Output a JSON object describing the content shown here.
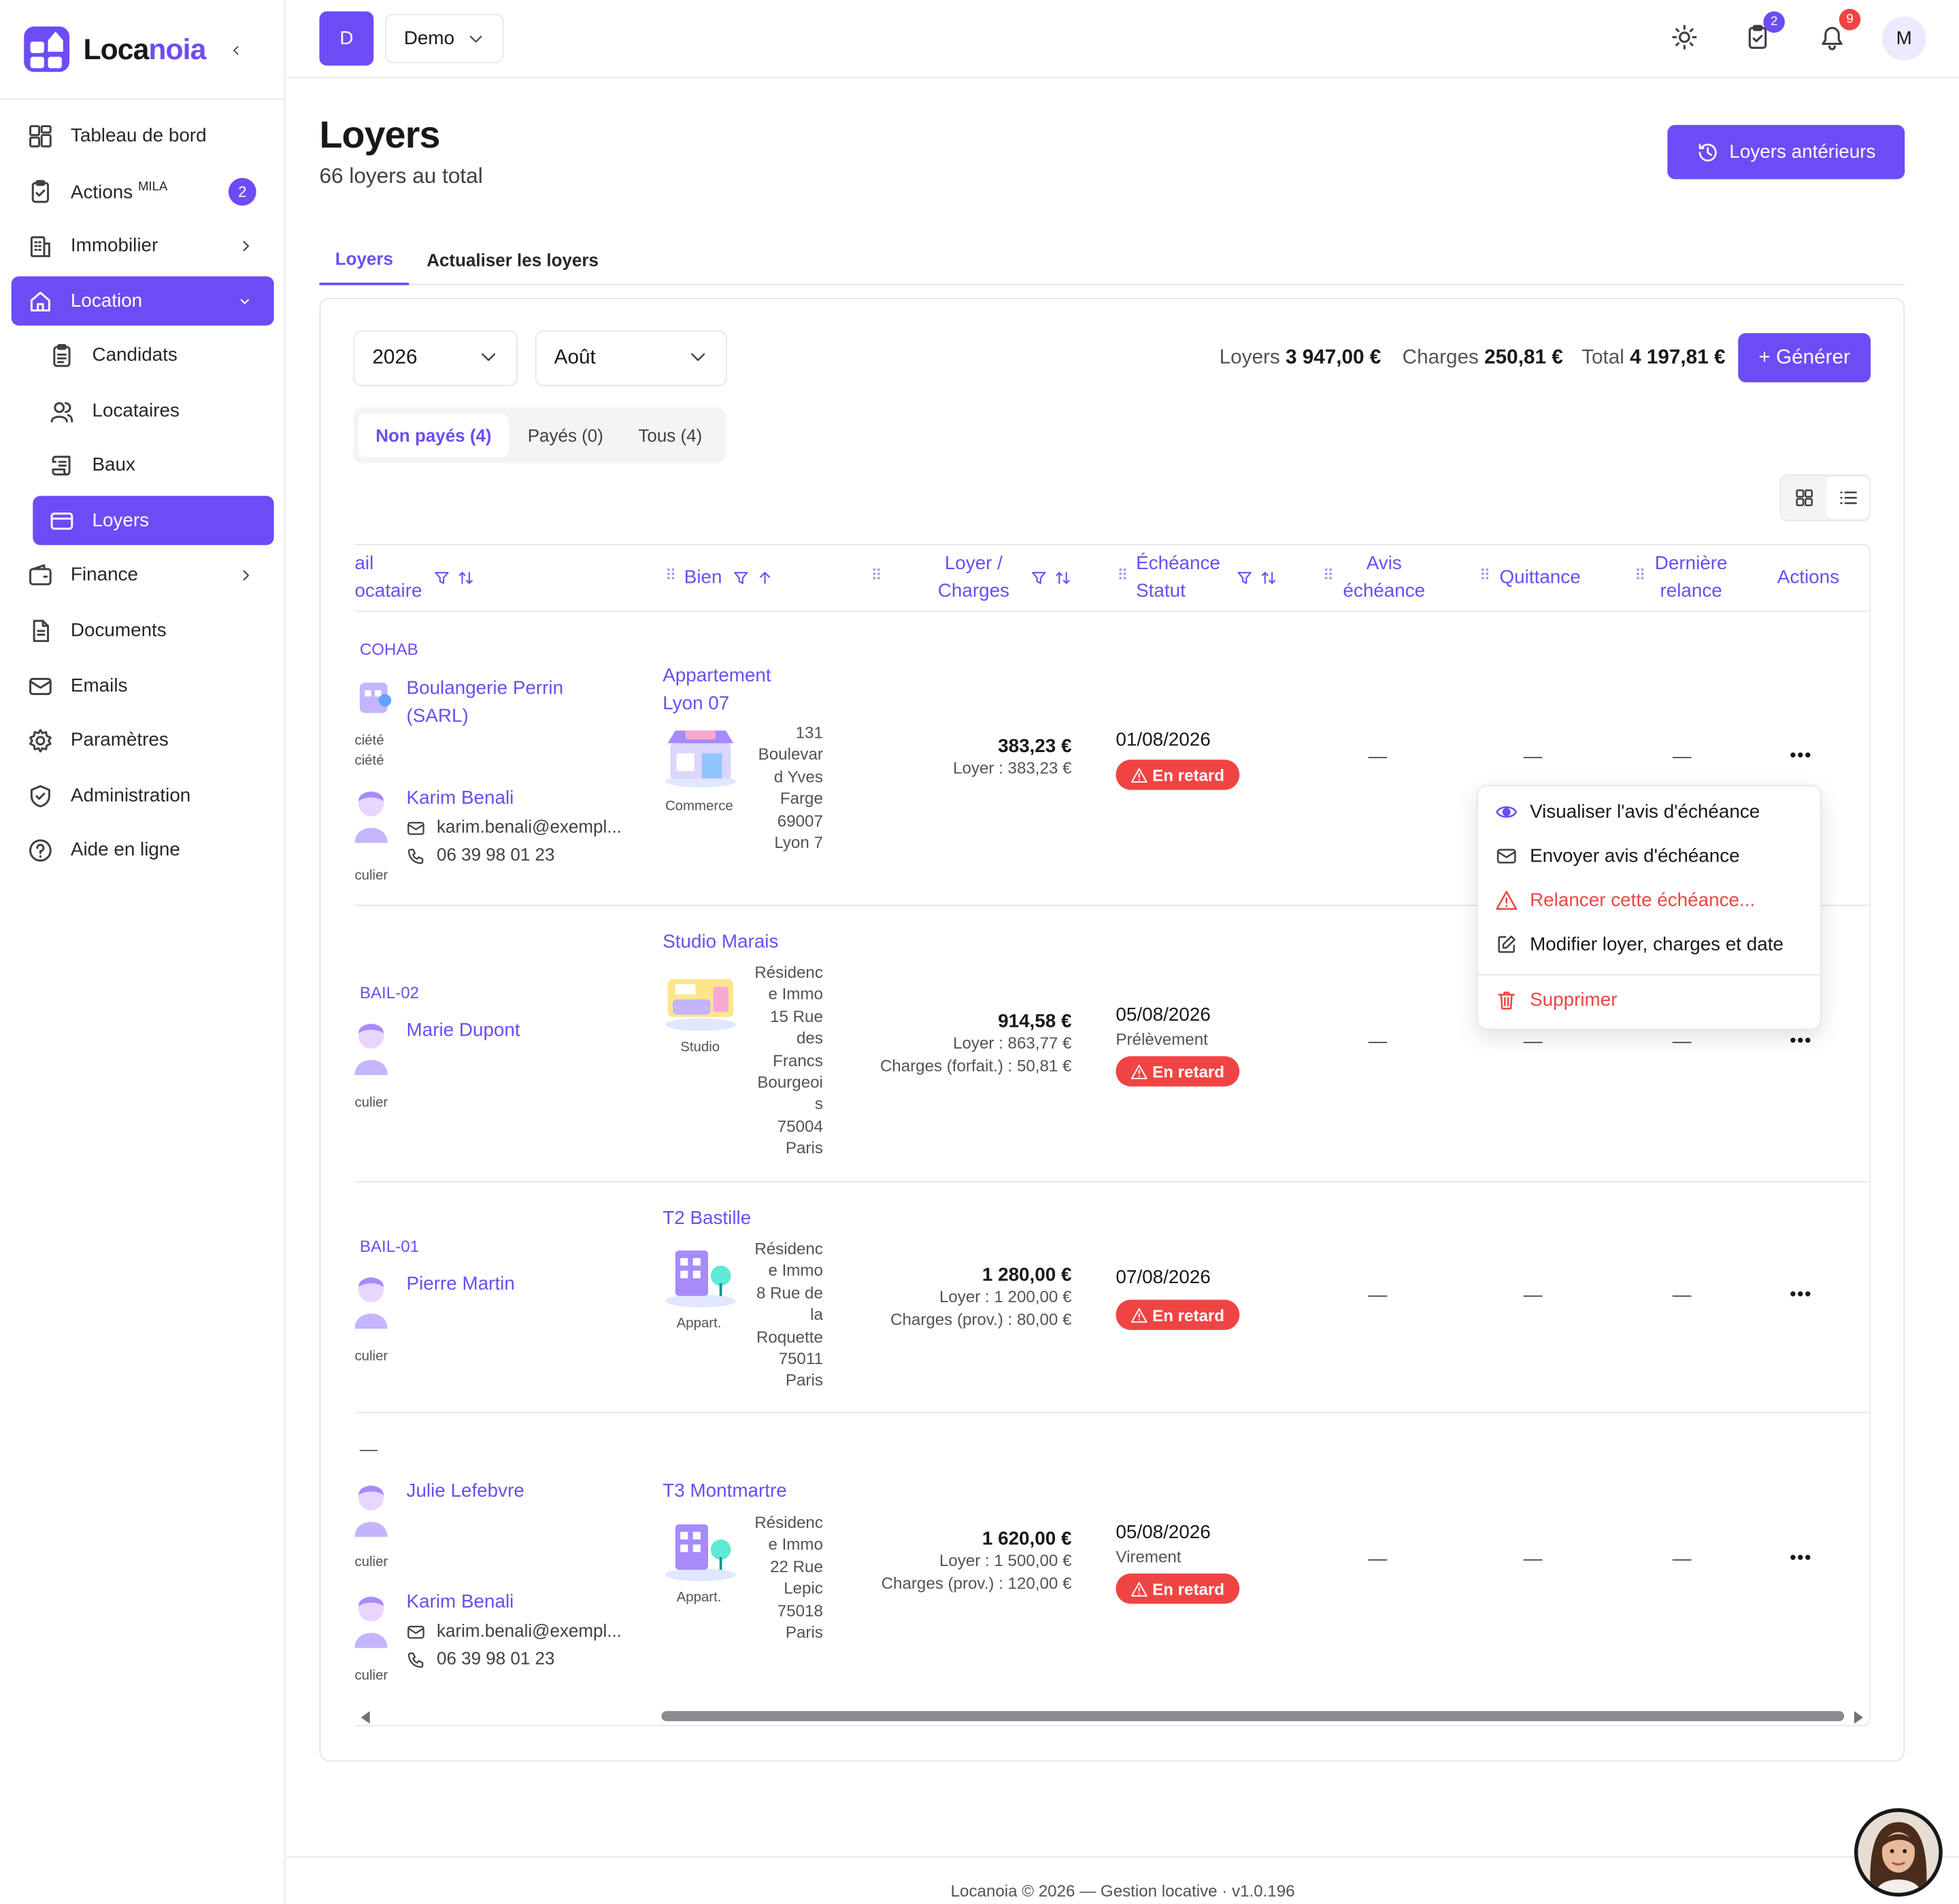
{
  "app": {
    "name_a": "Loca",
    "name_b": "noia"
  },
  "sidebar": {
    "items": [
      {
        "label": "Tableau de bord",
        "icon": "dashboard-icon"
      },
      {
        "label": "Actions",
        "sup": "MILA",
        "badge": "2",
        "icon": "clipboard-check-icon"
      },
      {
        "label": "Immobilier",
        "icon": "building-icon"
      },
      {
        "label": "Location",
        "icon": "home-icon"
      },
      {
        "label": "Candidats",
        "icon": "clipboard-list-icon"
      },
      {
        "label": "Locataires",
        "icon": "users-icon"
      },
      {
        "label": "Baux",
        "icon": "scroll-icon"
      },
      {
        "label": "Loyers",
        "icon": "credit-card-icon"
      },
      {
        "label": "Finance",
        "icon": "wallet-icon"
      },
      {
        "label": "Documents",
        "icon": "document-icon"
      },
      {
        "label": "Emails",
        "icon": "mail-icon"
      },
      {
        "label": "Paramètres",
        "icon": "gear-icon"
      },
      {
        "label": "Administration",
        "icon": "shield-icon"
      },
      {
        "label": "Aide en ligne",
        "icon": "help-circle-icon"
      }
    ]
  },
  "topbar": {
    "workspace_initial": "D",
    "workspace": "Demo",
    "tasks_badge": "2",
    "notif_badge": "9",
    "user_initial": "M"
  },
  "page": {
    "title": "Loyers",
    "subtitle": "66 loyers au total",
    "history_button": "Loyers antérieurs"
  },
  "tabs": [
    "Loyers",
    "Actualiser les loyers"
  ],
  "filters": {
    "year": "2026",
    "month": "Août"
  },
  "totals": {
    "rent_label": "Loyers",
    "rent": "3 947,00 €",
    "charges_label": "Charges",
    "charges": "250,81 €",
    "total_label": "Total",
    "total": "4 197,81 €",
    "generate": "+ Générer"
  },
  "segments": [
    "Non payés (4)",
    "Payés (0)",
    "Tous (4)"
  ],
  "columns": {
    "tenant_a": "ail",
    "tenant_b": "ocataire",
    "property": "Bien",
    "rent_a": "Loyer /",
    "rent_b": "Charges",
    "due_a": "Échéance",
    "due_b": "Statut",
    "notice_a": "Avis",
    "notice_b": "échéance",
    "receipt": "Quittance",
    "reminder_a": "Dernière",
    "reminder_b": "relance",
    "actions": "Actions"
  },
  "rows": [
    {
      "ref": "COHAB",
      "tenants": [
        {
          "name": "Boulangerie Perrin (SARL)",
          "type_a": "ciété",
          "type_b": "ciété"
        },
        {
          "name": "Karim Benali",
          "type": "culier",
          "email": "karim.benali@exempl...",
          "phone": "06 39 98 01 23"
        }
      ],
      "property": "Appartement Lyon 07",
      "kind": "Commerce",
      "address": [
        "131",
        "Boulevar",
        "d Yves",
        "Farge",
        "69007",
        "Lyon 7"
      ],
      "amount": "383,23 €",
      "detail": [
        "Loyer : 383,23 €"
      ],
      "due": "01/08/2026",
      "pay": "",
      "status": "En retard",
      "notice": "—",
      "receipt": "—",
      "reminder": "—"
    },
    {
      "ref": "BAIL-02",
      "tenants": [
        {
          "name": "Marie Dupont",
          "type": "culier"
        }
      ],
      "property": "Studio Marais",
      "kind": "Studio",
      "address": [
        "Résidenc",
        "e Immo",
        "15 Rue",
        "des",
        "Francs",
        "Bourgeoi",
        "s",
        "75004",
        "Paris"
      ],
      "amount": "914,58 €",
      "detail": [
        "Loyer : 863,77 €",
        "Charges (forfait.) : 50,81 €"
      ],
      "due": "05/08/2026",
      "pay": "Prélèvement",
      "status": "En retard",
      "notice": "—",
      "receipt": "—",
      "reminder": "—"
    },
    {
      "ref": "BAIL-01",
      "tenants": [
        {
          "name": "Pierre Martin",
          "type": "culier"
        }
      ],
      "property": "T2 Bastille",
      "kind": "Appart.",
      "address": [
        "Résidenc",
        "e Immo",
        "8 Rue de",
        "la",
        "Roquette",
        "75011",
        "Paris"
      ],
      "amount": "1 280,00 €",
      "detail": [
        "Loyer : 1 200,00 €",
        "Charges (prov.) : 80,00 €"
      ],
      "due": "07/08/2026",
      "pay": "",
      "status": "En retard",
      "notice": "—",
      "receipt": "—",
      "reminder": "—"
    },
    {
      "ref": "—",
      "tenants": [
        {
          "name": "Julie Lefebvre",
          "type": "culier"
        },
        {
          "name": "Karim Benali",
          "type": "culier",
          "email": "karim.benali@exempl...",
          "phone": "06 39 98 01 23"
        }
      ],
      "property": "T3 Montmartre",
      "kind": "Appart.",
      "address": [
        "Résidenc",
        "e Immo",
        "22 Rue",
        "Lepic",
        "75018",
        "Paris"
      ],
      "amount": "1 620,00 €",
      "detail": [
        "Loyer : 1 500,00 €",
        "Charges (prov.) : 120,00 €"
      ],
      "due": "05/08/2026",
      "pay": "Virement",
      "status": "En retard",
      "notice": "—",
      "receipt": "—",
      "reminder": "—"
    }
  ],
  "row_menu": {
    "items": [
      "Visualiser l'avis d'échéance",
      "Envoyer avis d'échéance",
      "Relancer cette échéance...",
      "Modifier loyer, charges et date",
      "Supprimer"
    ]
  },
  "footer": "Locanoia © 2026 — Gestion locative · v1.0.196",
  "colors": {
    "accent": "#6d4cf5",
    "danger": "#ef4444"
  }
}
